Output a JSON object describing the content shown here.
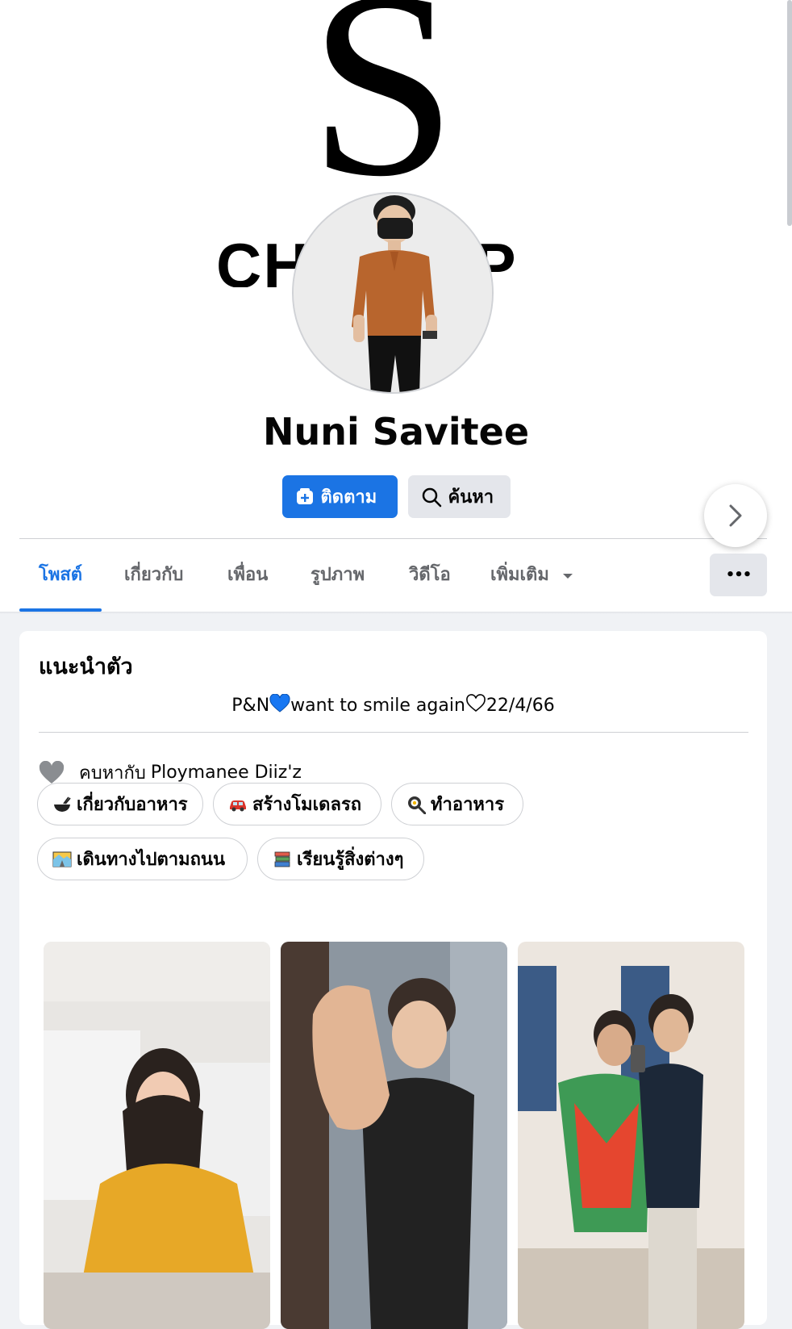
{
  "profile": {
    "name": "Nuni Savitee",
    "cover_letter": "S",
    "cover_wordmark": "CHAMPIP"
  },
  "actions": {
    "follow_label": "ติดตาม",
    "search_label": "ค้นหา"
  },
  "tabs": [
    {
      "label": "โพสต์",
      "active": true
    },
    {
      "label": "เกี่ยวกับ",
      "active": false
    },
    {
      "label": "เพื่อน",
      "active": false
    },
    {
      "label": "รูปภาพ",
      "active": false
    },
    {
      "label": "วิดีโอ",
      "active": false
    },
    {
      "label": "เพิ่มเติม",
      "active": false
    }
  ],
  "more_menu_glyph": "•••",
  "intro": {
    "title": "แนะนำตัว",
    "bio_part1": "P&N",
    "bio_part2": "want to smile again",
    "bio_part3": "22/4/66",
    "relationship_label": "คบหากับ",
    "relationship_partner": "Ploymanee Diiz'z",
    "hobbies": [
      {
        "label": "เกี่ยวกับอาหาร",
        "icon": "food-bowl-icon"
      },
      {
        "label": "สร้างโมเดลรถ",
        "icon": "car-icon"
      },
      {
        "label": "ทำอาหาร",
        "icon": "frying-pan-icon"
      },
      {
        "label": "เดินทางไปตามถนน",
        "icon": "road-trip-icon"
      },
      {
        "label": "เรียนรู้สิ่งต่างๆ",
        "icon": "books-icon"
      }
    ]
  },
  "colors": {
    "accent": "#1b74e4",
    "secondary_button": "#e4e6eb",
    "muted_text": "#65676b"
  }
}
